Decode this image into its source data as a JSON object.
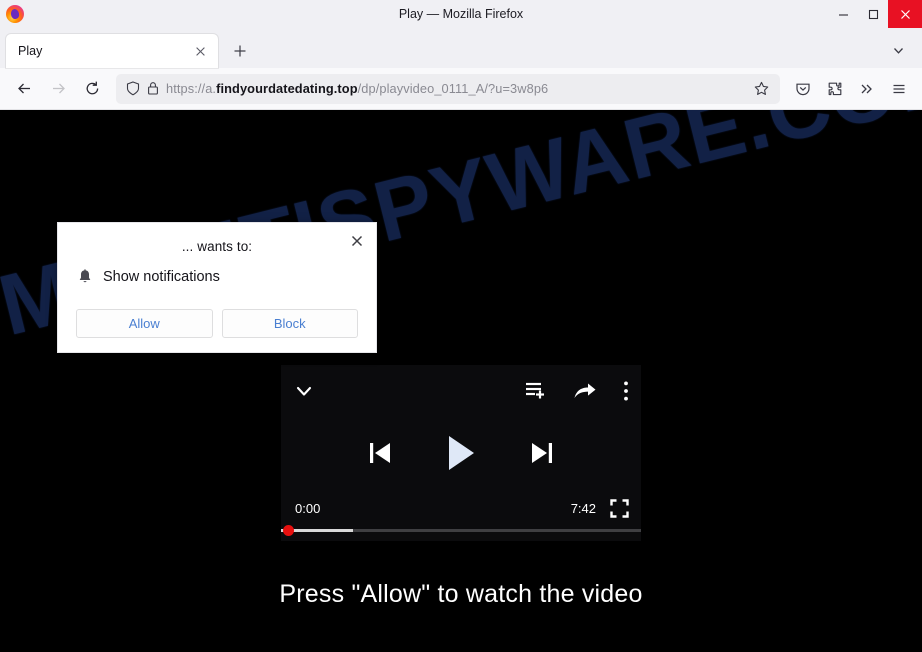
{
  "window": {
    "title": "Play — Mozilla Firefox",
    "logo_icon": "firefox-logo",
    "controls": {
      "minimize": "minimize-icon",
      "maximize": "maximize-icon",
      "close": "close-icon"
    }
  },
  "tabs": {
    "items": [
      {
        "label": "Play",
        "close_icon": "tab-close-icon"
      }
    ],
    "new_tab_icon": "plus-icon",
    "list_all_icon": "chevron-down-icon"
  },
  "toolbar": {
    "back_icon": "back-arrow-icon",
    "forward_icon": "forward-arrow-icon",
    "reload_icon": "reload-icon",
    "shield_icon": "shield-icon",
    "lock_icon": "lock-icon",
    "url": {
      "scheme": "https://",
      "subdomain": "a.",
      "host": "findyourdatedating.top",
      "path": "/dp/playvideo_0111_A/?u=3w8p6",
      "full": "https://a.findyourdatedating.top/dp/playvideo_0111_A/?u=3w8p6"
    },
    "bookmark_icon": "star-icon",
    "pocket_icon": "pocket-icon",
    "extensions_icon": "puzzle-piece-icon",
    "overflow_icon": "double-chevron-right-icon",
    "menu_icon": "hamburger-menu-icon"
  },
  "page": {
    "watermark": "MYANTISPYWARE.COM",
    "cta_text": "Press \"Allow\" to watch the video",
    "player": {
      "collapse_icon": "chevron-down-icon",
      "playlist_add_icon": "playlist-add-icon",
      "share_icon": "share-arrow-icon",
      "more_icon": "kebab-menu-icon",
      "previous_icon": "skip-previous-icon",
      "play_icon": "play-icon",
      "next_icon": "skip-next-icon",
      "current_time": "0:00",
      "total_time": "7:42",
      "fullscreen_icon": "fullscreen-icon",
      "progress_percent": 0,
      "buffered_percent": 20
    }
  },
  "permission_popup": {
    "title": "... wants to:",
    "bell_icon": "bell-icon",
    "permission_label": "Show notifications",
    "allow_label": "Allow",
    "block_label": "Block",
    "close_icon": "close-icon"
  },
  "colors": {
    "accent_blue": "#4a7fd1",
    "close_red": "#e81123",
    "progress_red": "#e8100f",
    "watermark_blue": "#14244c"
  }
}
